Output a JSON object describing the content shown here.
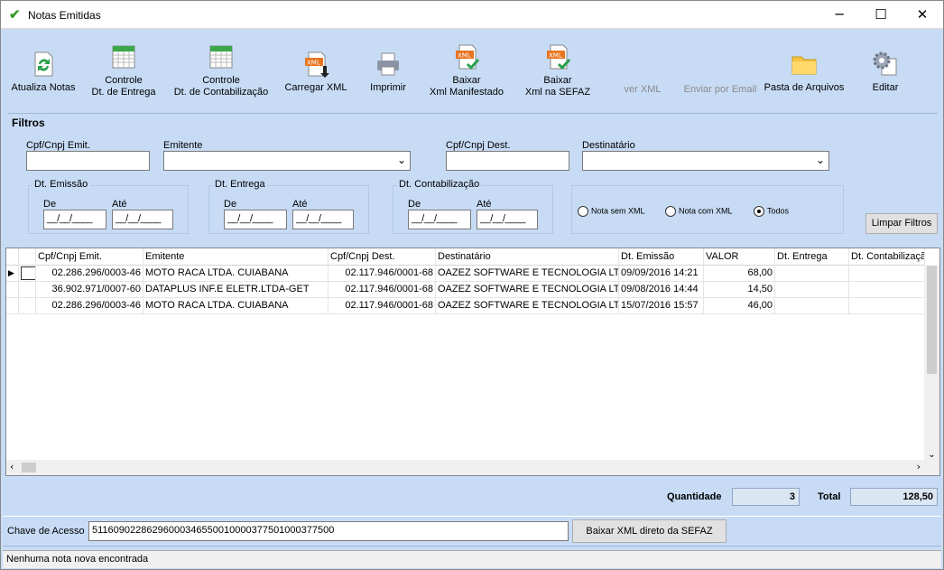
{
  "window": {
    "title": "Notas Emitidas",
    "minimize": "─",
    "maximize": "☐",
    "close": "✕"
  },
  "toolbar": {
    "atualiza": "Atualiza Notas",
    "controle_entrega_1": "Controle",
    "controle_entrega_2": "Dt. de Entrega",
    "controle_contab_1": "Controle",
    "controle_contab_2": "Dt. de Contabilização",
    "carregar_xml": "Carregar XML",
    "imprimir": "Imprimir",
    "baixar_manif_1": "Baixar",
    "baixar_manif_2": "Xml Manifestado",
    "baixar_sefaz_1": "Baixar",
    "baixar_sefaz_2": "Xml na SEFAZ",
    "ver_xml": "ver XML",
    "enviar_email": "Enviar por Email",
    "pasta": "Pasta de Arquivos",
    "editar": "Editar"
  },
  "filters": {
    "title": "Filtros",
    "cpf_emit_label": "Cpf/Cnpj Emit.",
    "cpf_emit_value": "",
    "emitente_label": "Emitente",
    "emitente_value": "",
    "cpf_dest_label": "Cpf/Cnpj Dest.",
    "cpf_dest_value": "",
    "destinatario_label": "Destinatário",
    "destinatario_value": "",
    "dt_emissao": "Dt. Emissão",
    "dt_entrega": "Dt. Entrega",
    "dt_contab": "Dt. Contabilização",
    "de": "De",
    "ate": "Até",
    "date_mask": "__/__/____",
    "radio_sem": "Nota sem XML",
    "radio_com": "Nota com XML",
    "radio_todos": "Todos",
    "selected_radio": "Todos",
    "limpar": "Limpar Filtros"
  },
  "grid": {
    "columns": [
      "Cpf/Cnpj Emit.",
      "Emitente",
      "Cpf/Cnpj Dest.",
      "Destinatário",
      "Dt. Emissão",
      "VALOR",
      "Dt. Entrega",
      "Dt. Contabilizaçã"
    ],
    "rows": [
      [
        "02.286.296/0003-46",
        "MOTO RACA  LTDA. CUIABANA",
        "02.117.946/0001-68",
        "OAZEZ SOFTWARE E TECNOLOGIA LTDA",
        "09/09/2016 14:21",
        "68,00",
        "",
        ""
      ],
      [
        "36.902.971/0007-60",
        "DATAPLUS INF.E ELETR.LTDA-GET",
        "02.117.946/0001-68",
        "OAZEZ SOFTWARE E TECNOLOGIA LTDA",
        "09/08/2016 14:44",
        "14,50",
        "",
        ""
      ],
      [
        "02.286.296/0003-46",
        "MOTO RACA  LTDA. CUIABANA",
        "02.117.946/0001-68",
        "OAZEZ SOFTWARE E TECNOLOGIA LTDA",
        "15/07/2016 15:57",
        "46,00",
        "",
        ""
      ]
    ]
  },
  "totals": {
    "quantidade_label": "Quantidade",
    "quantidade": "3",
    "total_label": "Total",
    "total": "128,50"
  },
  "chave": {
    "label": "Chave de Acesso",
    "value": "51160902286296000346550010000377501000377500",
    "button": "Baixar XML direto da SEFAZ"
  },
  "status": "Nenhuma nota nova encontrada"
}
